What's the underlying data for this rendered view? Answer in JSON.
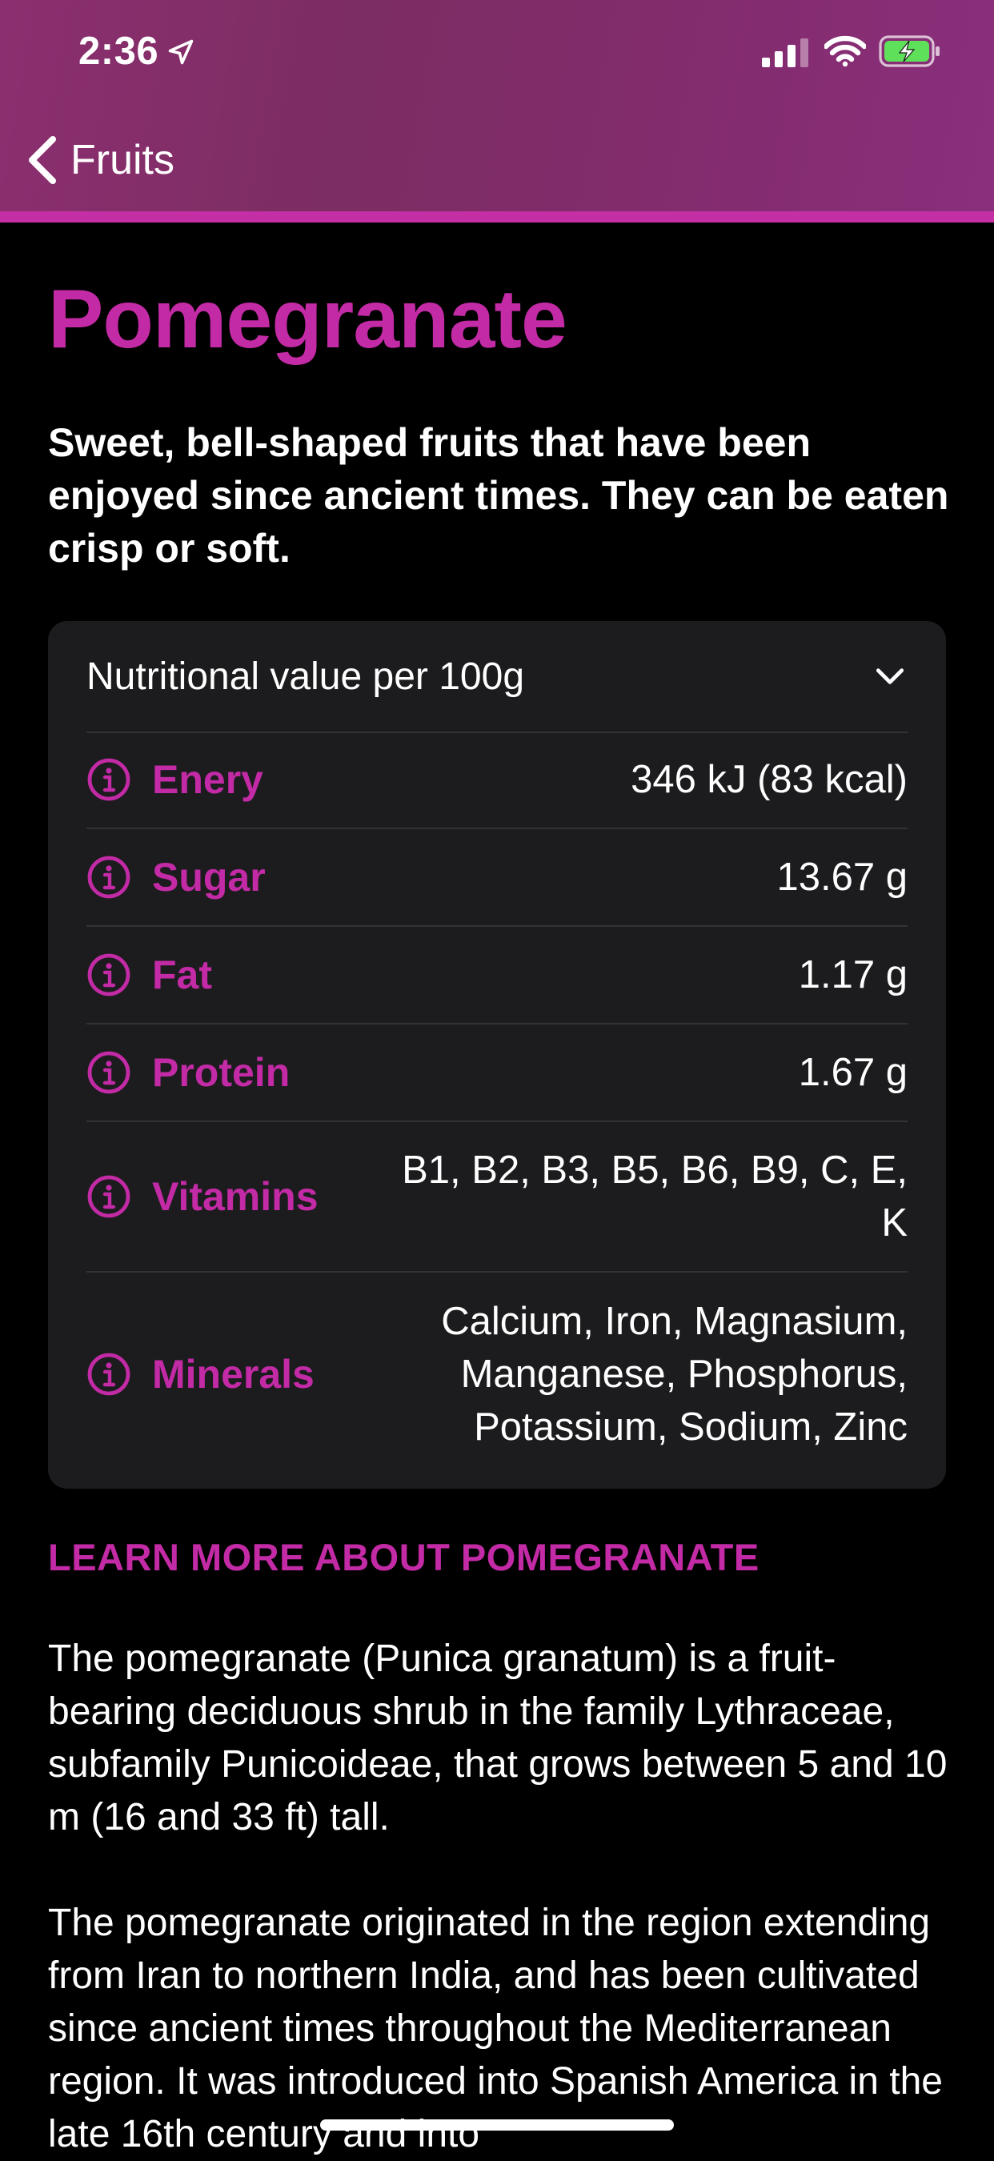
{
  "status_bar": {
    "time": "2:36"
  },
  "nav": {
    "back_label": "Fruits"
  },
  "page": {
    "title": "Pomegranate",
    "subtitle": "Sweet, bell-shaped fruits that have been enjoyed since ancient times. They can be eaten crisp or soft."
  },
  "nutrition": {
    "header": "Nutritional value per 100g",
    "rows": [
      {
        "name": "Enery",
        "value": "346 kJ (83 kcal)"
      },
      {
        "name": "Sugar",
        "value": "13.67 g"
      },
      {
        "name": "Fat",
        "value": "1.17 g"
      },
      {
        "name": "Protein",
        "value": "1.67 g"
      },
      {
        "name": "Vitamins",
        "value": "B1, B2, B3, B5, B6, B9, C, E, K"
      },
      {
        "name": "Minerals",
        "value": "Calcium, Iron, Magnasium, Manganese, Phosphorus, Potassium, Sodium, Zinc"
      }
    ]
  },
  "learn_more": {
    "heading": "LEARN MORE ABOUT POMEGRANATE",
    "paragraphs": [
      "The pomegranate (Punica granatum) is a fruit-bearing deciduous shrub in the family Lythraceae, subfamily Punicoideae, that grows between 5 and 10 m (16 and 33 ft) tall.",
      "The pomegranate originated in the region extending from Iran to northern India, and has been cultivated since ancient times throughout the Mediterranean region. It was introduced into Spanish America in the late 16th century and into"
    ]
  },
  "colors": {
    "accent": "#c32aa5",
    "nav_bar": "#7f2d66",
    "card_bg": "#1c1c1e",
    "background": "#000000"
  },
  "icons": {
    "location": "location-arrow-icon",
    "signal": "cellular-signal-icon",
    "wifi": "wifi-icon",
    "battery": "battery-charging-icon",
    "back": "chevron-left-icon",
    "expand": "chevron-down-icon",
    "info": "info-circle-icon"
  }
}
